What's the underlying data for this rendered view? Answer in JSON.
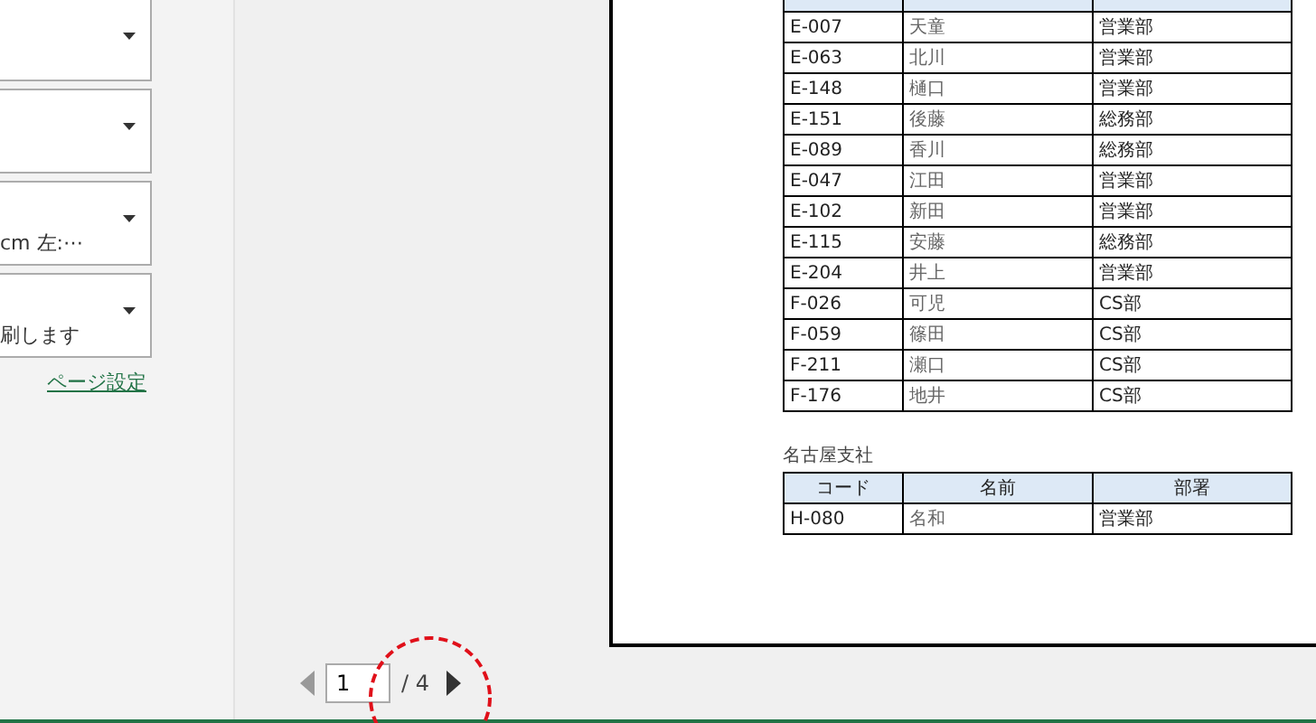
{
  "settings": {
    "dropdowns": [
      {
        "kind": "dropdown"
      },
      {
        "kind": "dropdown"
      },
      {
        "kind": "dropdown",
        "value": "cm 左:⋯"
      },
      {
        "kind": "dropdown",
        "value": "刷します"
      }
    ],
    "link": "ページ設定"
  },
  "preview": {
    "sections": [
      {
        "rows": [
          [
            "E-007",
            "天童",
            "営業部"
          ],
          [
            "E-063",
            "北川",
            "営業部"
          ],
          [
            "E-148",
            "樋口",
            "営業部"
          ],
          [
            "E-151",
            "後藤",
            "総務部"
          ],
          [
            "E-089",
            "香川",
            "総務部"
          ],
          [
            "E-047",
            "江田",
            "営業部"
          ],
          [
            "E-102",
            "新田",
            "営業部"
          ],
          [
            "E-115",
            "安藤",
            "総務部"
          ],
          [
            "E-204",
            "井上",
            "営業部"
          ],
          [
            "F-026",
            "可児",
            "CS部"
          ],
          [
            "F-059",
            "篠田",
            "CS部"
          ],
          [
            "F-211",
            "瀬口",
            "CS部"
          ],
          [
            "F-176",
            "地井",
            "CS部"
          ]
        ]
      },
      {
        "title": "名古屋支社",
        "columns": [
          "コード",
          "名前",
          "部署"
        ],
        "rows": [
          [
            "H-080",
            "名和",
            "営業部"
          ]
        ]
      }
    ]
  },
  "pager": {
    "current": "1",
    "total": "/ 4",
    "highlighted": true
  }
}
